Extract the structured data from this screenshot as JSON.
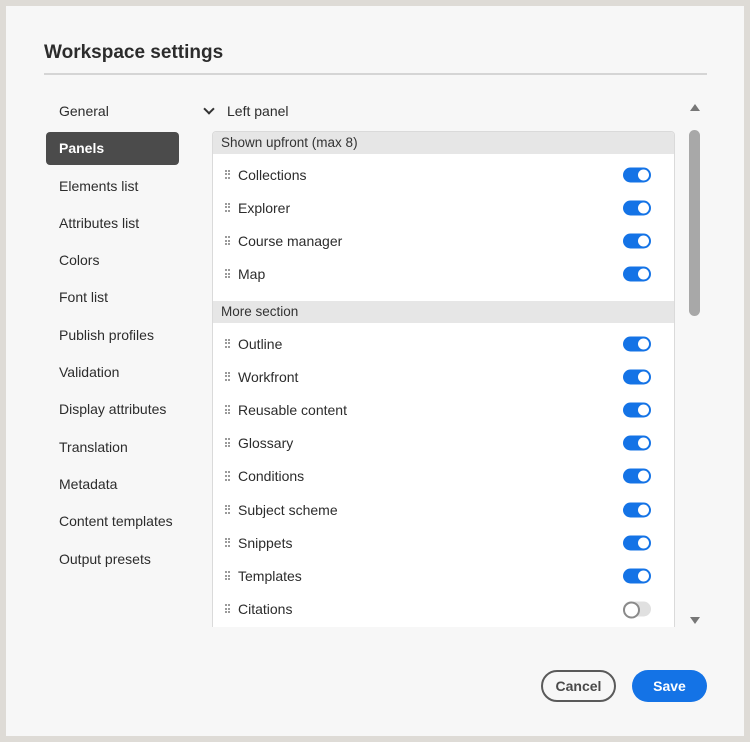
{
  "dialog": {
    "title": "Workspace settings"
  },
  "nav": {
    "items": [
      {
        "label": "General",
        "active": false
      },
      {
        "label": "Panels",
        "active": true
      },
      {
        "label": "Elements list",
        "active": false
      },
      {
        "label": "Attributes list",
        "active": false
      },
      {
        "label": "Colors",
        "active": false
      },
      {
        "label": "Font list",
        "active": false
      },
      {
        "label": "Publish profiles",
        "active": false
      },
      {
        "label": "Validation",
        "active": false
      },
      {
        "label": "Display attributes",
        "active": false
      },
      {
        "label": "Translation",
        "active": false
      },
      {
        "label": "Metadata",
        "active": false
      },
      {
        "label": "Content templates",
        "active": false
      },
      {
        "label": "Output presets",
        "active": false
      }
    ]
  },
  "panel": {
    "section_label": "Left panel",
    "shown_group": {
      "label": "Shown upfront (max 8)",
      "items": [
        {
          "label": "Collections",
          "enabled": true
        },
        {
          "label": "Explorer",
          "enabled": true
        },
        {
          "label": "Course manager",
          "enabled": true
        },
        {
          "label": "Map",
          "enabled": true
        }
      ]
    },
    "more_group": {
      "label": "More section",
      "items": [
        {
          "label": "Outline",
          "enabled": true
        },
        {
          "label": "Workfront",
          "enabled": true
        },
        {
          "label": "Reusable content",
          "enabled": true
        },
        {
          "label": "Glossary",
          "enabled": true
        },
        {
          "label": "Conditions",
          "enabled": true
        },
        {
          "label": "Subject scheme",
          "enabled": true
        },
        {
          "label": "Snippets",
          "enabled": true
        },
        {
          "label": "Templates",
          "enabled": true
        },
        {
          "label": "Citations",
          "enabled": false
        }
      ]
    }
  },
  "footer": {
    "cancel_label": "Cancel",
    "save_label": "Save"
  },
  "colors": {
    "accent": "#1473e6",
    "nav_active": "#4b4b4b",
    "group_header": "#e6e6e6"
  }
}
